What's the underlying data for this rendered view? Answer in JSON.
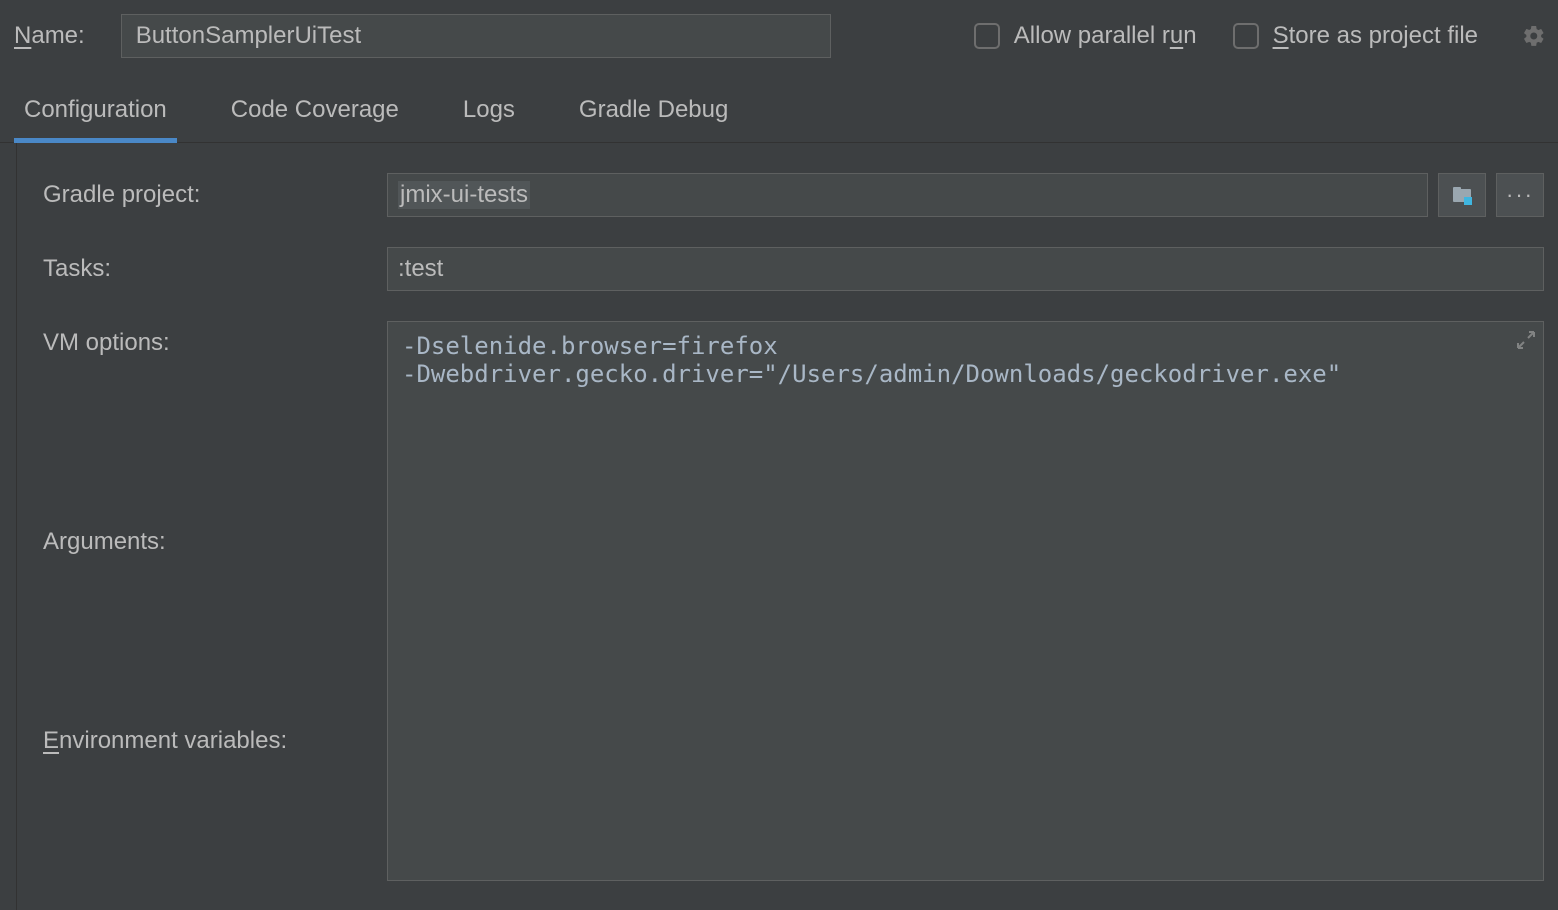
{
  "header": {
    "name_label_pre": "N",
    "name_label_post": "ame:",
    "name_value": "ButtonSamplerUiTest",
    "allow_parallel_pre": "Allow parallel r",
    "allow_parallel_mid": "u",
    "allow_parallel_post": "n",
    "store_pre": "S",
    "store_post": "tore as project file"
  },
  "tabs": {
    "config": "Configuration",
    "coverage": "Code Coverage",
    "logs": "Logs",
    "gradle_debug": "Gradle Debug"
  },
  "form": {
    "gradle_project_label": "Gradle project:",
    "gradle_project_value": "jmix-ui-tests",
    "tasks_label": "Tasks:",
    "tasks_value": ":test",
    "vm_options_label": "VM options:",
    "vm_options_value": "-Dselenide.browser=firefox\n-Dwebdriver.gecko.driver=\"/Users/admin/Downloads/geckodriver.exe\"",
    "arguments_label": "Arguments:",
    "env_label_pre": "E",
    "env_label_post": "nvironment variables:"
  }
}
